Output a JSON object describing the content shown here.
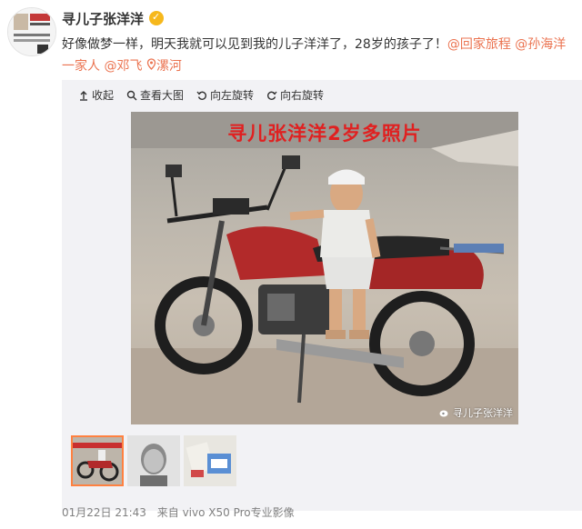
{
  "post": {
    "username": "寻儿子张洋洋",
    "text": "好像做梦一样，明天我就可以见到我的儿子洋洋了，28岁的孩子了！",
    "mention1": "@回家旅程",
    "mention2": "@孙海洋一家人",
    "mention3": "@邓飞",
    "location": "漯河"
  },
  "toolbar": {
    "collapse": "收起",
    "view_large": "查看大图",
    "rotate_left": "向左旋转",
    "rotate_right": "向右旋转"
  },
  "photo": {
    "caption": "寻儿张洋洋2岁多照片",
    "watermark": "寻儿子张洋洋"
  },
  "footer": {
    "time": "01月22日 21:43",
    "source": "来自 vivo X50 Pro专业影像"
  },
  "colors": {
    "link": "#eb7350",
    "caption": "#e02020",
    "verified": "#f6b81c"
  }
}
